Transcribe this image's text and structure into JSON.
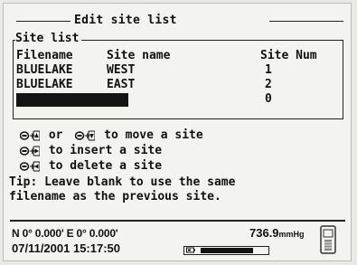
{
  "title": "Edit site list",
  "site_list": {
    "legend": "Site list",
    "columns": [
      "Filename",
      "Site name",
      "Site Num"
    ],
    "rows": [
      {
        "filename": "BLUELAKE",
        "site_name": "WEST",
        "site_num": "1"
      },
      {
        "filename": "BLUELAKE",
        "site_name": "EAST",
        "site_num": "2"
      }
    ],
    "new_row": {
      "filename": "",
      "site_name": "",
      "site_num": "0"
    }
  },
  "help": {
    "line1_or": "or",
    "line1_text": "to move a site",
    "line2_text": "to insert a site",
    "line3_text": "to delete a site"
  },
  "tip": {
    "line1": "Tip: Leave blank to use the same",
    "line2": "filename as the previous site."
  },
  "status_bar": {
    "coordinates": "N 0° 0.000' E 0° 0.000'",
    "datetime": "07/11/2001 15:17:50",
    "pressure_value": "736.9",
    "pressure_unit": "mmHg",
    "battery_level_fraction": 0.8
  },
  "icons": {
    "key_combo": "power-plus-arrow-icon",
    "battery": "battery-icon",
    "device": "device-icon"
  }
}
